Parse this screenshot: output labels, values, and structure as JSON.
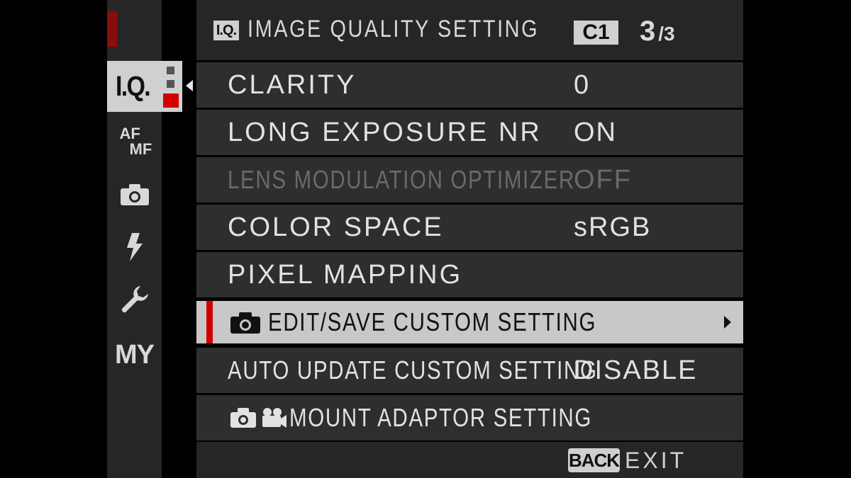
{
  "header": {
    "badge": "I.Q.",
    "title": "IMAGE QUALITY SETTING",
    "custom_badge": "C1",
    "page_current": "3",
    "page_total": "/3"
  },
  "sidebar": {
    "tabs": [
      {
        "id": "iq",
        "label": "I.Q.",
        "active": true,
        "icon": "iq-icon"
      },
      {
        "id": "afmf",
        "label_top": "AF",
        "label_bottom": "MF",
        "icon": "af-mf-icon"
      },
      {
        "id": "shooting",
        "icon": "camera-icon"
      },
      {
        "id": "flash",
        "icon": "flash-icon"
      },
      {
        "id": "setup",
        "icon": "wrench-icon"
      },
      {
        "id": "my",
        "label": "MY",
        "icon": "my-menu-icon"
      }
    ]
  },
  "menu": {
    "items": [
      {
        "label": "CLARITY",
        "value": "0",
        "enabled": true
      },
      {
        "label": "LONG EXPOSURE NR",
        "value": "ON",
        "enabled": true
      },
      {
        "label": "LENS MODULATION OPTIMIZER",
        "value": "OFF",
        "enabled": false
      },
      {
        "label": "COLOR SPACE",
        "value": "sRGB",
        "enabled": true
      },
      {
        "label": "PIXEL MAPPING",
        "value": "",
        "enabled": true
      },
      {
        "label": "EDIT/SAVE CUSTOM SETTING",
        "value": "",
        "enabled": true,
        "selected": true,
        "icon": "camera-icon"
      },
      {
        "label": "AUTO UPDATE CUSTOM SETTING",
        "value": "DISABLE",
        "enabled": true
      },
      {
        "label": "MOUNT ADAPTOR SETTING",
        "value": "",
        "enabled": true,
        "icons": [
          "camera-icon",
          "movie-camera-icon"
        ]
      }
    ]
  },
  "footer": {
    "back_badge": "BACK",
    "exit_label": "EXIT"
  },
  "colors": {
    "accent_red": "#cc0000",
    "selected_row": "#c8c8c8",
    "row_bg": "#2e2e2e",
    "text": "#e2e2e2",
    "disabled_text": "#6a6a6a"
  }
}
